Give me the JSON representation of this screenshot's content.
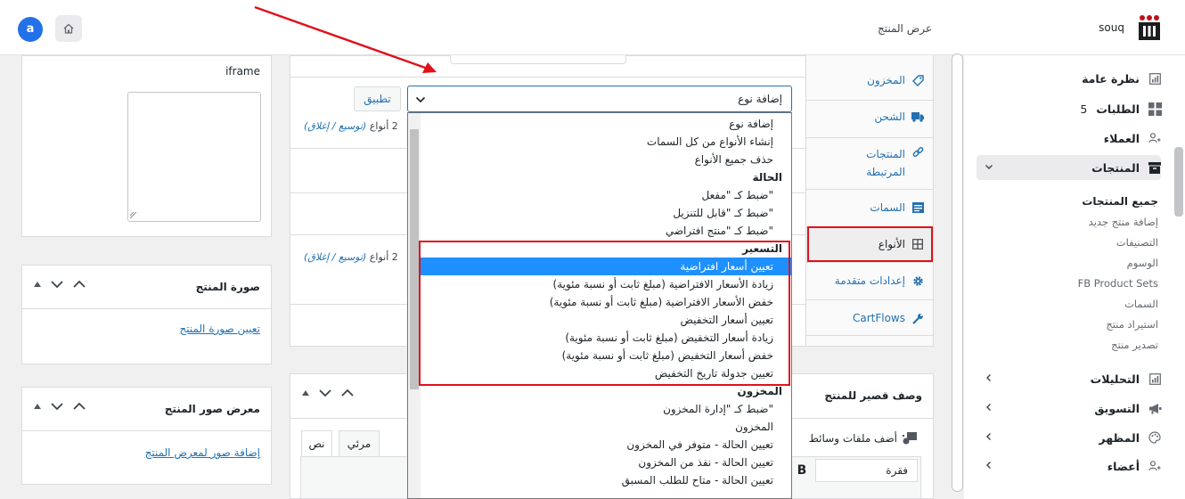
{
  "header": {
    "avatar_letter": "a",
    "breadcrumb": "عرض المنتج",
    "brand": "souq",
    "accent": "#2271b1",
    "highlight": "#e0111b"
  },
  "sidebar": {
    "items": [
      {
        "label": "نظرة عامة",
        "icon": "chart-icon"
      },
      {
        "label": "الطلبات",
        "count": "5",
        "icon": "grid-icon"
      },
      {
        "label": "العملاء",
        "icon": "users-icon"
      },
      {
        "label": "المنتجات",
        "icon": "archive-icon",
        "active": true
      },
      {
        "label": "التحليلات",
        "icon": "chart-icon"
      },
      {
        "label": "التسويق",
        "icon": "megaphone-icon"
      },
      {
        "label": "المظهر",
        "icon": "palette-icon"
      },
      {
        "label": "أعضاء",
        "icon": "users-icon"
      }
    ],
    "submenu": [
      "جميع المنتجات",
      "إضافة منتج جديد",
      "التصنيفات",
      "الوسوم",
      "FB Product Sets",
      "السمات",
      "استيراد منتج",
      "تصدير منتج"
    ]
  },
  "product_data": {
    "tabs": [
      {
        "label": "المخزون",
        "icon": "tag-icon"
      },
      {
        "label": "الشحن",
        "icon": "truck-icon"
      },
      {
        "label": "المنتجات المرتبطة",
        "icon": "link-icon"
      },
      {
        "label": "السمات",
        "icon": "list-icon"
      },
      {
        "label": "الأنواع",
        "icon": "grid-icon",
        "active": true
      },
      {
        "label": "إعدادات متقدمة",
        "icon": "gear-icon"
      },
      {
        "label": "CartFlows",
        "icon": "wrench-icon"
      }
    ],
    "apply_label": "تطبيق",
    "select_value": "إضافة نوع",
    "variations_count": "2 أنواع",
    "expand_link": "(توسيع / إغلاق)"
  },
  "dropdown": {
    "options": [
      {
        "label": "إضافة نوع"
      },
      {
        "label": "إنشاء الأنواع من كل السمات"
      },
      {
        "label": "حذف جميع الأنواع"
      },
      {
        "label": "الحالة",
        "group": true
      },
      {
        "label": "ضبط كـ \"مفعل\""
      },
      {
        "label": "ضبط كـ \"قابل للتنزيل\""
      },
      {
        "label": "ضبط كـ \"منتج افتراضي\""
      },
      {
        "label": "التسعير",
        "group": true
      },
      {
        "label": "تعيين أسعار افتراضية",
        "selected": true
      },
      {
        "label": "زيادة الأسعار الافتراضية (مبلغ ثابت أو نسبة مئوية)"
      },
      {
        "label": "خفض الأسعار الافتراضية (مبلغ ثابت أو نسبة مئوية)"
      },
      {
        "label": "تعيين أسعار التخفيض"
      },
      {
        "label": "زيادة أسعار التخفيض (مبلغ ثابت أو نسبة مئوية)"
      },
      {
        "label": "خفض أسعار التخفيض (مبلغ ثابت أو نسبة مئوية)"
      },
      {
        "label": "تعيين جدولة تاريخ التخفيض"
      },
      {
        "label": "المخزون",
        "group": true
      },
      {
        "label": "ضبط كـ \"إدارة المخزون\""
      },
      {
        "label": "المخزون"
      },
      {
        "label": "تعيين الحالة - متوفر في المخزون"
      },
      {
        "label": "تعيين الحالة - نفذ من المخزون"
      },
      {
        "label": "تعيين الحالة - متاح للطلب المسبق"
      }
    ]
  },
  "left": {
    "iframe_label": "iframe",
    "image_panel": {
      "title": "صورة المنتج",
      "link": "تعيين صورة المنتج"
    },
    "gallery_panel": {
      "title": "معرض صور المنتج",
      "link": "إضافة صور لمعرض المنتج"
    }
  },
  "short_desc": {
    "title": "وصف قصير للمنتج",
    "add_files": "أضف ملفات وسائط",
    "tab_visual": "مرئي",
    "tab_text": "نص",
    "paragraph": "فقرة",
    "bold": "B"
  }
}
